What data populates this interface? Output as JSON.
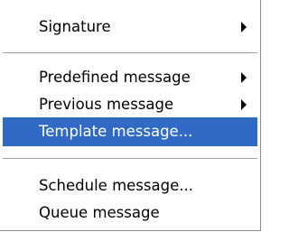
{
  "menu": {
    "items": [
      {
        "label": "Signature",
        "has_submenu": true
      },
      {
        "label": "Predefined message",
        "has_submenu": true
      },
      {
        "label": "Previous message",
        "has_submenu": true
      },
      {
        "label": "Template message...",
        "has_submenu": false,
        "selected": true
      },
      {
        "label": "Schedule message...",
        "has_submenu": false
      },
      {
        "label": "Queue message",
        "has_submenu": false
      }
    ]
  },
  "colors": {
    "selection_background": "#316ac5",
    "selection_text": "#ffffff",
    "text": "#000000",
    "separator": "#a0a0a0"
  },
  "icons": {
    "submenu_arrow": "submenu-arrow-icon"
  }
}
